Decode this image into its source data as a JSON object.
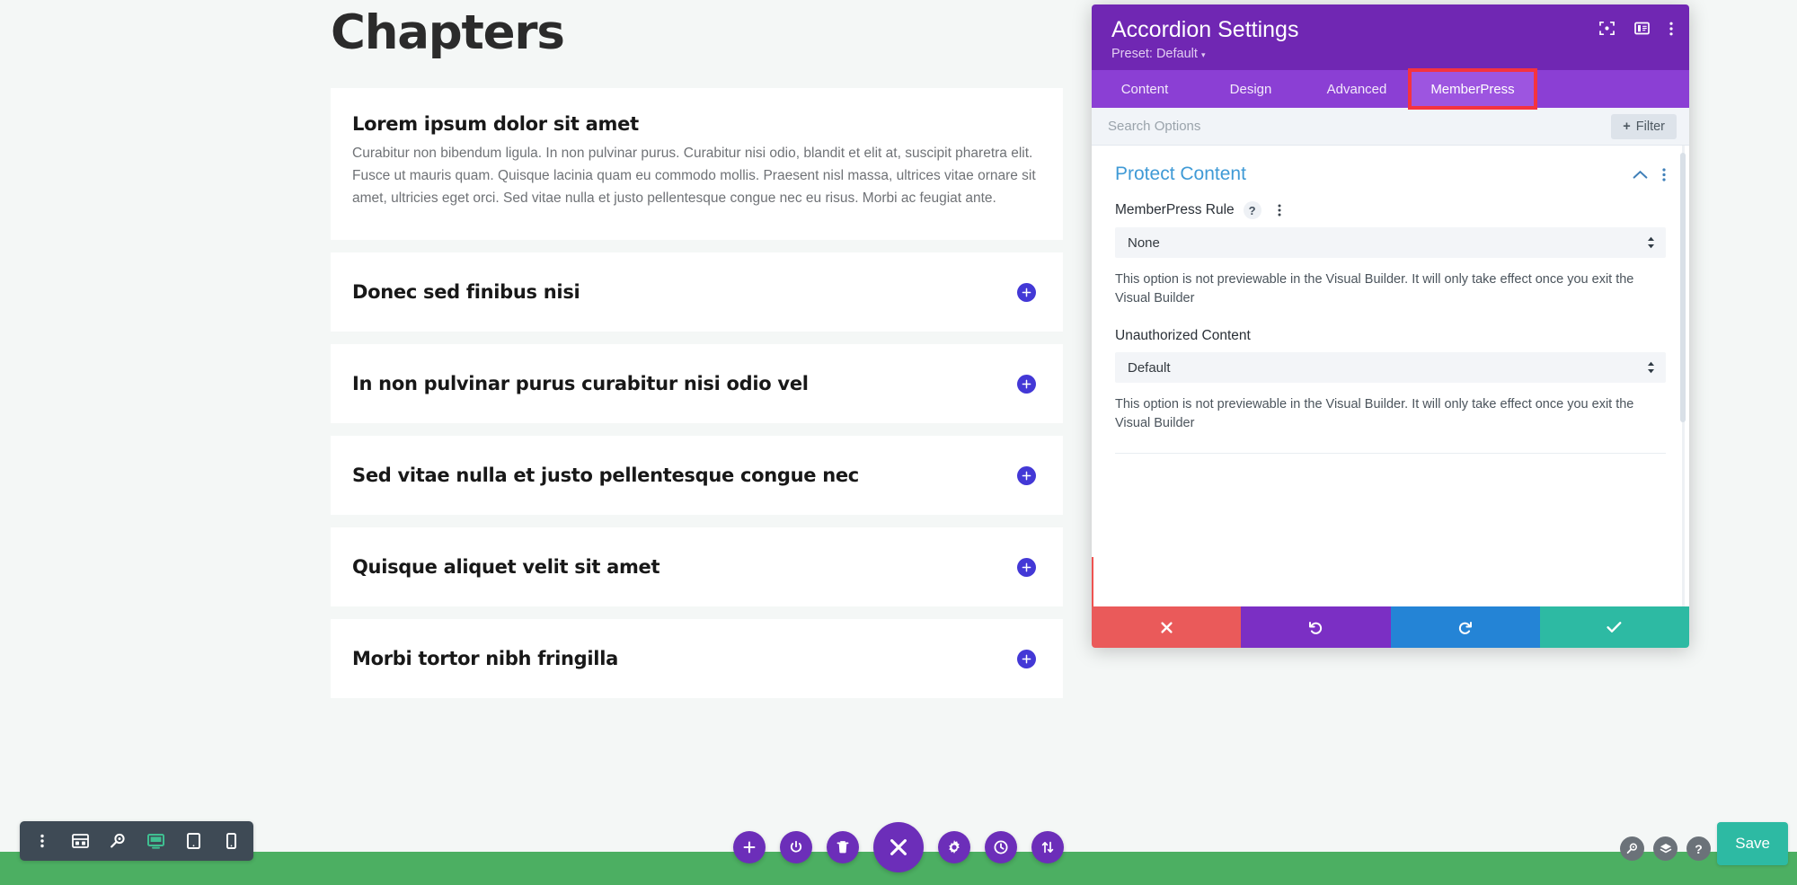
{
  "site": {
    "page_title": "Chapters",
    "accordion_items": [
      {
        "title": "Lorem ipsum dolor sit amet",
        "open": true,
        "body": "Curabitur non bibendum ligula. In non pulvinar purus. Curabitur nisi odio, blandit et elit at, suscipit pharetra elit. Fusce ut mauris quam. Quisque lacinia quam eu commodo mollis. Praesent nisl massa, ultrices vitae ornare sit amet, ultricies eget orci. Sed vitae nulla et justo pellentesque congue nec eu risus. Morbi ac feugiat ante."
      },
      {
        "title": "Donec sed finibus nisi",
        "open": false,
        "body": ""
      },
      {
        "title": "In non pulvinar purus curabitur nisi odio vel",
        "open": false,
        "body": ""
      },
      {
        "title": "Sed vitae nulla et justo pellentesque congue nec",
        "open": false,
        "body": ""
      },
      {
        "title": "Quisque aliquet velit sit amet",
        "open": false,
        "body": ""
      },
      {
        "title": "Morbi tortor nibh fringilla",
        "open": false,
        "body": ""
      }
    ]
  },
  "settings": {
    "title": "Accordion Settings",
    "preset": "Preset: Default",
    "header_icons": [
      {
        "name": "focus-mode-icon"
      },
      {
        "name": "panel-layout-icon"
      },
      {
        "name": "more-options-icon"
      }
    ],
    "tabs": [
      {
        "label": "Content",
        "active": false
      },
      {
        "label": "Design",
        "active": false
      },
      {
        "label": "Advanced",
        "active": false
      },
      {
        "label": "MemberPress",
        "active": true
      }
    ],
    "search": {
      "placeholder": "Search Options",
      "value": ""
    },
    "filter_label": "Filter",
    "section": {
      "title": "Protect Content",
      "fields": [
        {
          "label": "MemberPress Rule",
          "value": "None",
          "options": [
            "None"
          ],
          "note": "This option is not previewable in the Visual Builder. It will only take effect once you exit the Visual Builder",
          "has_help": true,
          "has_menu": true
        },
        {
          "label": "Unauthorized Content",
          "value": "Default",
          "options": [
            "Default"
          ],
          "note": "This option is not previewable in the Visual Builder. It will only take effect once you exit the Visual Builder",
          "has_help": false,
          "has_menu": false
        }
      ]
    },
    "actions": [
      {
        "name": "cancel",
        "icon": "close-icon"
      },
      {
        "name": "undo",
        "icon": "undo-icon"
      },
      {
        "name": "redo",
        "icon": "redo-icon"
      },
      {
        "name": "save",
        "icon": "check-icon"
      }
    ]
  },
  "toolbars": {
    "left": [
      {
        "name": "more-options-icon",
        "active": false
      },
      {
        "name": "wireframe-view-icon",
        "active": false
      },
      {
        "name": "zoom-out-view-icon",
        "active": false
      },
      {
        "name": "desktop-view-icon",
        "active": true
      },
      {
        "name": "tablet-view-icon",
        "active": false
      },
      {
        "name": "phone-view-icon",
        "active": false
      }
    ],
    "center": [
      {
        "name": "add-icon",
        "main": false
      },
      {
        "name": "power-icon",
        "main": false
      },
      {
        "name": "trash-icon",
        "main": false
      },
      {
        "name": "close-icon",
        "main": true
      },
      {
        "name": "settings-gear-icon",
        "main": false
      },
      {
        "name": "history-clock-icon",
        "main": false
      },
      {
        "name": "portability-icon",
        "main": false
      }
    ],
    "right": [
      {
        "name": "search-icon"
      },
      {
        "name": "layers-icon"
      },
      {
        "name": "help-icon"
      }
    ],
    "save_label": "Save"
  },
  "colors": {
    "header_purple": "#7027b3",
    "tab_purple": "#8b3fd4",
    "tab_active": "#9d55e0",
    "highlight_red": "#f5333f",
    "section_blue": "#3f9ad6",
    "accent_green": "#4caf62",
    "save_teal": "#2dbaa3",
    "accordion_toggle": "#4338d6"
  }
}
